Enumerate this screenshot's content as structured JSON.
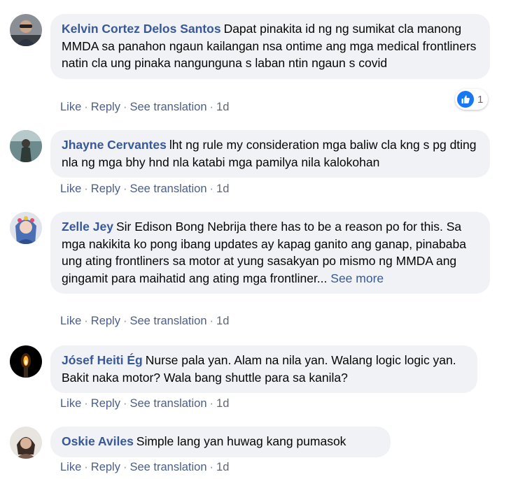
{
  "comments": [
    {
      "author": "Kelvin Cortez Delos Santos",
      "text": "Dapat pinakita id ng ng sumikat cla manong MMDA sa panahon ngaun kailangan nsa ontime ang mga medical frontliners natin cla ung pinaka nangunguna s laban ntin ngaun s covid",
      "see_more": "",
      "actions": {
        "like": "Like",
        "reply": "Reply",
        "translate": "See translation",
        "time": "1d"
      },
      "reactions": {
        "icon": "like-icon",
        "count": "1"
      }
    },
    {
      "author": "Jhayne Cervantes",
      "text": "lht ng rule my consideration mga baliw cla kng s pg dting nla ng mga bhy hnd nla katabi mga pamilya nila kalokohan",
      "see_more": "",
      "actions": {
        "like": "Like",
        "reply": "Reply",
        "translate": "See translation",
        "time": "1d"
      }
    },
    {
      "author": "Zelle Jey",
      "text": "Sir Edison Bong Nebrija there has to be a reason po for this. Sa mga nakikita ko pong ibang updates ay kapag ganito ang ganap, pinababa ung ating frontliners sa motor at yung sasakyan po mismo ng MMDA ang gingamit para maihatid ang ating mga frontliner...",
      "see_more": "See more",
      "actions": {
        "like": "Like",
        "reply": "Reply",
        "translate": "See translation",
        "time": "1d"
      }
    },
    {
      "author": "Jósef Heiti Ég",
      "text": "Nurse pala yan. Alam na nila yan. Walang logic logic yan. Bakit naka motor? Wala bang shuttle para sa kanila?",
      "see_more": "",
      "actions": {
        "like": "Like",
        "reply": "Reply",
        "translate": "See translation",
        "time": "1d"
      }
    },
    {
      "author": "Oskie Aviles",
      "text": "Simple lang yan huwag kang pumasok",
      "see_more": "",
      "actions": {
        "like": "Like",
        "reply": "Reply",
        "translate": "See translation",
        "time": "1d"
      }
    }
  ],
  "colors": {
    "author": "#385898",
    "bubble": "#f0f2f5",
    "meta": "#65676b",
    "like_badge": "#1877f2"
  }
}
